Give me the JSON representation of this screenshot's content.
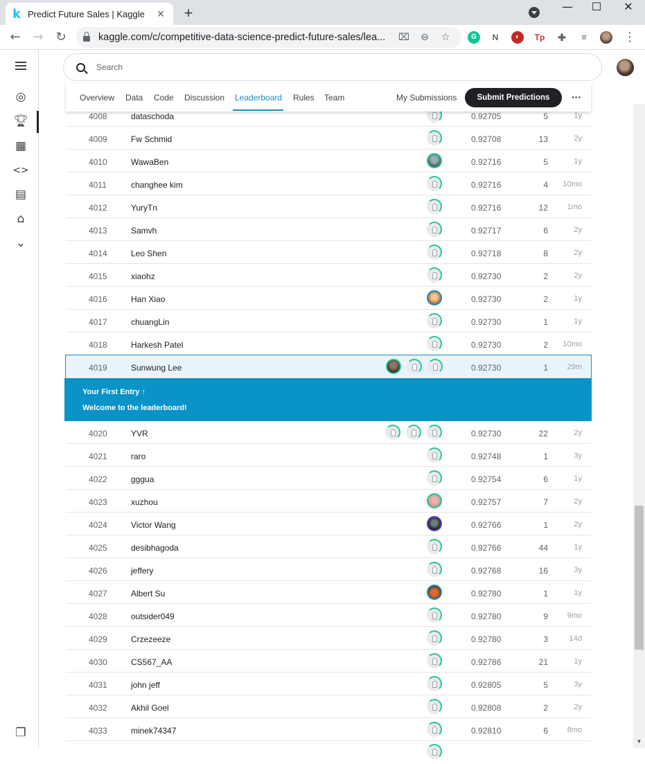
{
  "browser": {
    "tab_title": "Predict Future Sales | Kaggle",
    "tab_favicon": "k",
    "url": "kaggle.com/c/competitive-data-science-predict-future-sales/lea..."
  },
  "search": {
    "placeholder": "Search"
  },
  "competition_tabs": {
    "items": [
      "Overview",
      "Data",
      "Code",
      "Discussion",
      "Leaderboard",
      "Rules",
      "Team"
    ],
    "active": "Leaderboard",
    "my_submissions": "My Submissions",
    "submit": "Submit Predictions",
    "more": "···"
  },
  "banner": {
    "title": "Your First Entry ↑",
    "subtitle": "Welcome to the leaderboard!"
  },
  "rows": [
    {
      "rank": "4008",
      "name": "dataschoda",
      "score": "0.92705",
      "entries": "5",
      "last": "1y"
    },
    {
      "rank": "4009",
      "name": "Fw Schmid",
      "score": "0.92708",
      "entries": "13",
      "last": "2y"
    },
    {
      "rank": "4010",
      "name": "WawaBen",
      "score": "0.92716",
      "entries": "5",
      "last": "1y"
    },
    {
      "rank": "4011",
      "name": "changhee kim",
      "score": "0.92716",
      "entries": "4",
      "last": "10mo"
    },
    {
      "rank": "4012",
      "name": "YuryTn",
      "score": "0.92716",
      "entries": "12",
      "last": "1mo"
    },
    {
      "rank": "4013",
      "name": "Samvh",
      "score": "0.92717",
      "entries": "6",
      "last": "2y"
    },
    {
      "rank": "4014",
      "name": "Leo Shen",
      "score": "0.92718",
      "entries": "8",
      "last": "2y"
    },
    {
      "rank": "4015",
      "name": "xiaohz",
      "score": "0.92730",
      "entries": "2",
      "last": "2y"
    },
    {
      "rank": "4016",
      "name": "Han Xiao",
      "score": "0.92730",
      "entries": "2",
      "last": "1y"
    },
    {
      "rank": "4017",
      "name": "chuangLin",
      "score": "0.92730",
      "entries": "1",
      "last": "1y"
    },
    {
      "rank": "4018",
      "name": "Harkesh Patel",
      "score": "0.92730",
      "entries": "2",
      "last": "10mo"
    },
    {
      "rank": "4019",
      "name": "Sunwung Lee",
      "score": "0.92730",
      "entries": "1",
      "last": "29m"
    },
    {
      "rank": "4020",
      "name": "YVR",
      "score": "0.92730",
      "entries": "22",
      "last": "2y"
    },
    {
      "rank": "4021",
      "name": "raro",
      "score": "0.92748",
      "entries": "1",
      "last": "3y"
    },
    {
      "rank": "4022",
      "name": "gggua",
      "score": "0.92754",
      "entries": "6",
      "last": "1y"
    },
    {
      "rank": "4023",
      "name": "xuzhou",
      "score": "0.92757",
      "entries": "7",
      "last": "2y"
    },
    {
      "rank": "4024",
      "name": "Victor Wang",
      "score": "0.92766",
      "entries": "1",
      "last": "2y"
    },
    {
      "rank": "4025",
      "name": "desibhagoda",
      "score": "0.92766",
      "entries": "44",
      "last": "1y"
    },
    {
      "rank": "4026",
      "name": "jeffery",
      "score": "0.92768",
      "entries": "16",
      "last": "3y"
    },
    {
      "rank": "4027",
      "name": "Albert Su",
      "score": "0.92780",
      "entries": "1",
      "last": "1y"
    },
    {
      "rank": "4028",
      "name": "outsider049",
      "score": "0.92780",
      "entries": "9",
      "last": "9mo"
    },
    {
      "rank": "4029",
      "name": "Crzezeeze",
      "score": "0.92780",
      "entries": "3",
      "last": "14d"
    },
    {
      "rank": "4030",
      "name": "CS567_AA",
      "score": "0.92786",
      "entries": "21",
      "last": "1y"
    },
    {
      "rank": "4031",
      "name": "john jeff",
      "score": "0.92805",
      "entries": "5",
      "last": "3y"
    },
    {
      "rank": "4032",
      "name": "Akhil Goel",
      "score": "0.92808",
      "entries": "2",
      "last": "2y"
    },
    {
      "rank": "4033",
      "name": "minek74347",
      "score": "0.92810",
      "entries": "6",
      "last": "8mo"
    }
  ]
}
